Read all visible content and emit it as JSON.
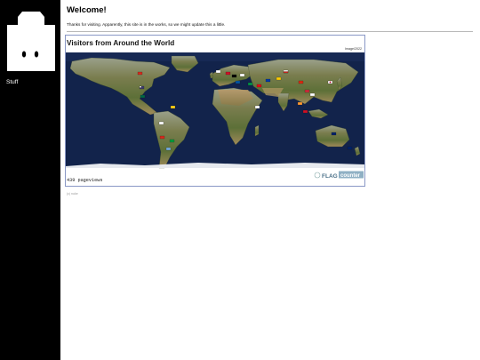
{
  "sidebar": {
    "nav": [
      {
        "label": "Stuff"
      }
    ]
  },
  "main": {
    "title": "Welcome!",
    "intro": "Thanks for visiting. Apparently, this site is in the works, so we might update this a little."
  },
  "flag_counter": {
    "title": "Visitors from Around the World",
    "badge": "Image/2022",
    "pageviews": "439 pageviews",
    "logo_left": "FLAG",
    "logo_right": "counter",
    "colors": {
      "ocean": "#12234b",
      "land": "#6d7546",
      "border": "#5a6fb0"
    }
  },
  "footer": {
    "note": "(c) nuke"
  }
}
